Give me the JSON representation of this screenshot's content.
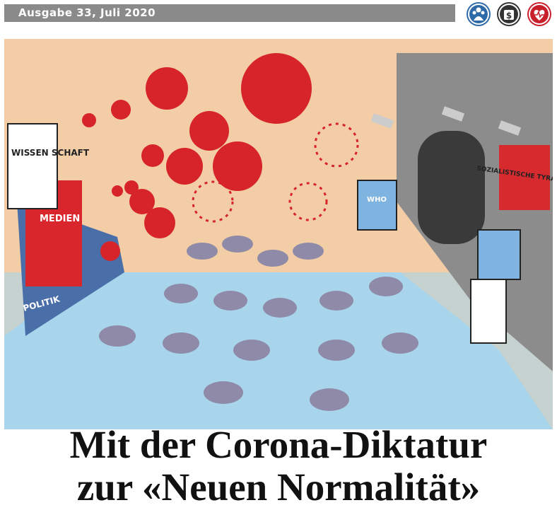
{
  "header": {
    "issue": "Ausgabe 33, Juli 2020",
    "icons": [
      {
        "name": "family-icon",
        "color": "#2f6aa8"
      },
      {
        "name": "money-bag-icon",
        "symbol": "$",
        "color": "#333333"
      },
      {
        "name": "heartbeat-icon",
        "color": "#c8202a"
      }
    ]
  },
  "cartoon": {
    "labels": {
      "science": "WISSEN\nSCHAFT",
      "media": "MEDIEN",
      "politics": "POLITIK",
      "sign": "SOZIALISTISCHE TYRANNEI",
      "who": "WHO"
    },
    "colors": {
      "sky": "#f2cda6",
      "ground": "#a9d5ec",
      "virus": "#d6242a",
      "people": "#8f8aa8",
      "wall": "#8c8c8c"
    }
  },
  "headline": {
    "line1": "Mit der Corona-Diktatur",
    "line2": "zur «Neuen Normalität»"
  }
}
